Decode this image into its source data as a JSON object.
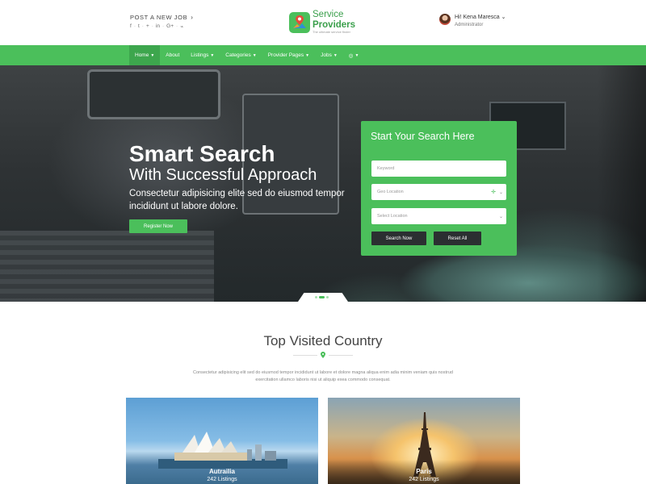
{
  "header": {
    "post_job": "POST A NEW JOB",
    "socials": [
      "facebook-icon",
      "twitter-icon",
      "google-plus-icon",
      "linkedin-icon",
      "google-plus-icon",
      "rss-icon"
    ],
    "logo": {
      "line1": "Service",
      "line2": "Providers",
      "tagline": "The ultimate service finder"
    },
    "user": {
      "greeting": "Hi! Kena Maresca",
      "role": "Administrator"
    }
  },
  "nav": {
    "items": [
      {
        "label": "Home",
        "dropdown": true,
        "active": true
      },
      {
        "label": "About",
        "dropdown": false,
        "active": false
      },
      {
        "label": "Listings",
        "dropdown": true,
        "active": false
      },
      {
        "label": "Categories",
        "dropdown": true,
        "active": false
      },
      {
        "label": "Provider Pages",
        "dropdown": true,
        "active": false
      },
      {
        "label": "Jobs",
        "dropdown": true,
        "active": false
      }
    ]
  },
  "hero": {
    "heading": "Smart Search",
    "subheading": "With Successful Approach",
    "text": "Consectetur adipisicing elite sed do eiusmod tempor incididunt ut labore dolore.",
    "register_label": "Register Now",
    "slider": {
      "count": 3,
      "active": 1
    }
  },
  "search": {
    "title": "Start Your Search Here",
    "keyword_placeholder": "Keyword",
    "geo_placeholder": "Geo Location",
    "location_placeholder": "Select Location",
    "search_label": "Search Now",
    "reset_label": "Reset All"
  },
  "section": {
    "title": "Top Visited Country",
    "description": "Consectetur adipisicing elit sed do eiusmod tempor incididunt ut labore et dolore magna aliqua enim adia minim veniam quis nostrud exercitation ullamco laboris nisi ut aliquip exea commodo consequat.",
    "cards": [
      {
        "name": "Autrailia",
        "listings": "242 Listings"
      },
      {
        "name": "Paris",
        "listings": "242 Listings"
      }
    ]
  },
  "colors": {
    "accent": "#4bbf5b",
    "accent_dark": "#3da64d",
    "button_dark": "#2b2f31"
  }
}
